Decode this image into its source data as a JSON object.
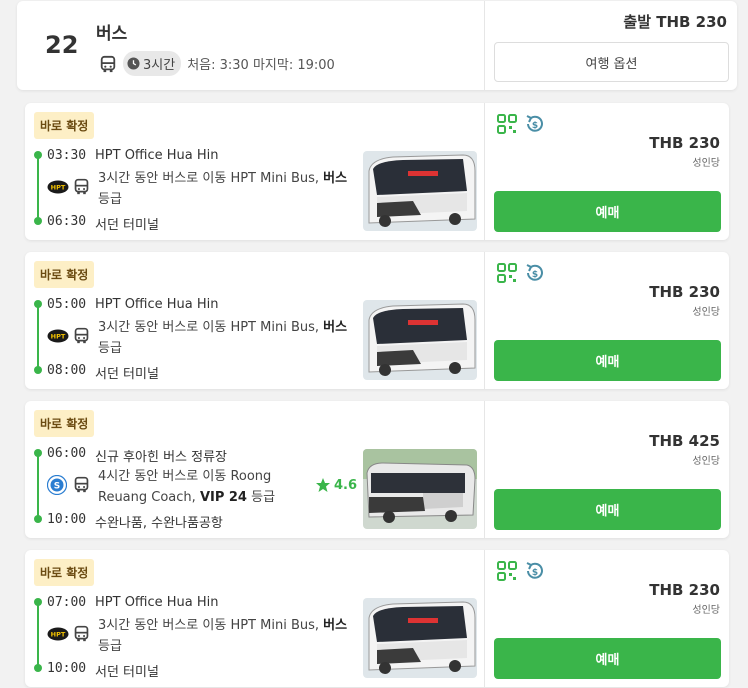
{
  "header": {
    "count": "22",
    "title": "버스",
    "duration": "3시간",
    "schedule": "처음: 3:30 마지막: 19:00",
    "from_price": "출발 THB 230",
    "options_button": "여행 옵션"
  },
  "colors": {
    "accent": "#3ab54a",
    "badge_bg": "#fdefc6"
  },
  "trips": [
    {
      "badge": "바로 확정",
      "dep_time": "03:30",
      "dep_stop": "HPT Office Hua Hin",
      "desc_pre": "3시간 동안 버스로 이동 HPT Mini Bus, ",
      "desc_class": "버스",
      "desc_post": " 등급",
      "arr_time": "06:30",
      "arr_stop": "서던 터미널",
      "operator_logo": "HPT",
      "icons": [
        "qr-ticket-icon",
        "refund-icon"
      ],
      "price": "THB 230",
      "per": "성인당",
      "book": "예매"
    },
    {
      "badge": "바로 확정",
      "dep_time": "05:00",
      "dep_stop": "HPT Office Hua Hin",
      "desc_pre": "3시간 동안 버스로 이동 HPT Mini Bus, ",
      "desc_class": "버스",
      "desc_post": " 등급",
      "arr_time": "08:00",
      "arr_stop": "서던 터미널",
      "operator_logo": "HPT",
      "icons": [
        "qr-ticket-icon",
        "refund-icon"
      ],
      "price": "THB 230",
      "per": "성인당",
      "book": "예매"
    },
    {
      "badge": "바로 확정",
      "dep_time": "06:00",
      "dep_stop": "신규 후아힌 버스 정류장",
      "desc_pre": "4시간 동안 버스로 이동 Roong Reuang Coach, ",
      "desc_class": "VIP 24",
      "desc_post": " 등급",
      "rating": "4.6",
      "arr_time": "10:00",
      "arr_stop": "수완나품, 수완나품공항",
      "operator_logo": "S",
      "icons": [],
      "price": "THB 425",
      "per": "성인당",
      "book": "예매"
    },
    {
      "badge": "바로 확정",
      "dep_time": "07:00",
      "dep_stop": "HPT Office Hua Hin",
      "desc_pre": "3시간 동안 버스로 이동 HPT Mini Bus, ",
      "desc_class": "버스",
      "desc_post": " 등급",
      "arr_time": "10:00",
      "arr_stop": "서던 터미널",
      "operator_logo": "HPT",
      "icons": [
        "qr-ticket-icon",
        "refund-icon"
      ],
      "price": "THB 230",
      "per": "성인당",
      "book": "예매"
    }
  ]
}
